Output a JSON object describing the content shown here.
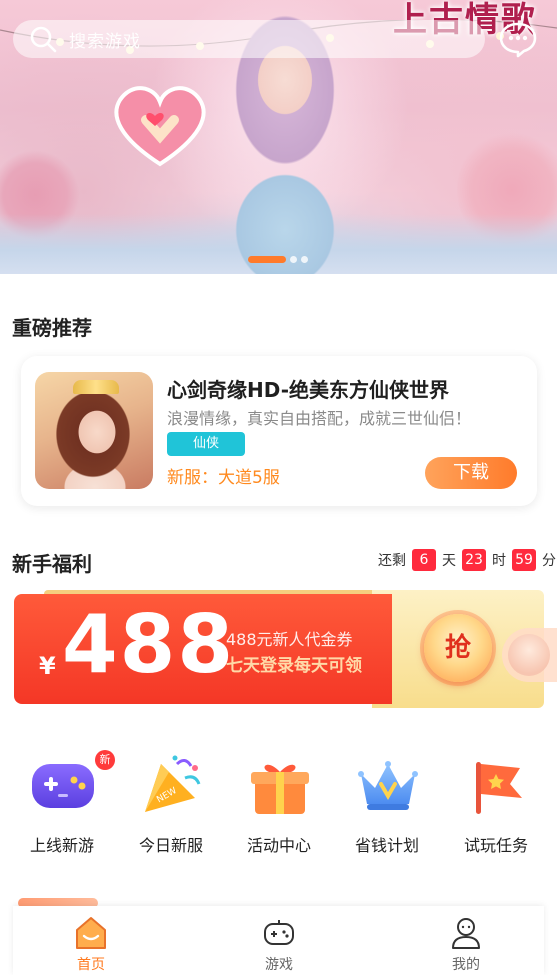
{
  "banner": {
    "search_placeholder": "搜索游戏",
    "title_art": "上古情歌",
    "slide_count": 3,
    "active_slide": 1
  },
  "featured": {
    "section_title": "重磅推荐",
    "game": {
      "name": "心剑奇缘HD-绝美东方仙侠世界",
      "description": "浪漫情缘，真实自由搭配，成就三世仙侣！",
      "tag": "仙侠",
      "server": "新服：大道5服",
      "download_label": "下载"
    }
  },
  "welfare": {
    "section_title": "新手福利",
    "countdown": {
      "prefix": "还剩",
      "days": "6",
      "days_unit": "天",
      "hours": "23",
      "hours_unit": "时",
      "minutes": "59",
      "minutes_unit": "分"
    },
    "coupon": {
      "currency": "¥",
      "amount": "488",
      "line1": "488元新人代金券",
      "line2": "七天登录每天可领",
      "grab_label": "抢"
    }
  },
  "quick_entries": [
    {
      "label": "上线新游",
      "icon": "gamepad-icon",
      "badge": "新"
    },
    {
      "label": "今日新服",
      "icon": "party-popper-icon"
    },
    {
      "label": "活动中心",
      "icon": "gift-box-icon"
    },
    {
      "label": "省钱计划",
      "icon": "crown-icon"
    },
    {
      "label": "试玩任务",
      "icon": "flag-icon"
    }
  ],
  "tabbar": {
    "items": [
      {
        "label": "首页",
        "icon": "home-icon",
        "active": true
      },
      {
        "label": "游戏",
        "icon": "gamepad-tab-icon",
        "active": false
      },
      {
        "label": "我的",
        "icon": "user-icon",
        "active": false
      }
    ]
  },
  "colors": {
    "accent": "#ff7b2b",
    "countdown_red": "#ff2a3d",
    "tag_cyan": "#20c4d8",
    "coupon_red": "#f43726"
  }
}
